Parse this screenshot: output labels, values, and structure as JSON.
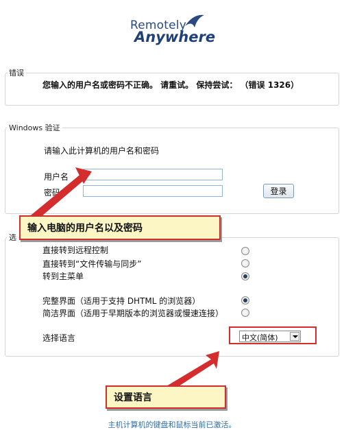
{
  "logo": {
    "line1": "Remotely",
    "line2": "Anywhere"
  },
  "error": {
    "legend": "错误",
    "message": "您输入的用户名或密码不正确。 请重试。 保持尝试： （错误 1326）"
  },
  "auth": {
    "legend": "Windows 验证",
    "prompt": "请输入此计算机的用户名和密码",
    "username_label": "用户名",
    "username_value": "",
    "password_label": "密码",
    "password_value": "",
    "login_button": "登录"
  },
  "options": {
    "legend": "选",
    "items": [
      {
        "label": "直接转到远程控制",
        "selected": false
      },
      {
        "label": "直接转到“文件传输与同步”",
        "selected": false
      },
      {
        "label": "转到主菜单",
        "selected": true
      },
      {
        "label": "完整界面（适用于支持 DHTML 的浏览器）",
        "selected": true
      },
      {
        "label": "简洁界面（适用于早期版本的浏览器或慢速连接）",
        "selected": false
      }
    ],
    "language_label": "选择语言",
    "language_value": "中文(简体)"
  },
  "annotations": {
    "callout1": "输入电脑的用户名以及密码",
    "callout2": "设置语言",
    "border_color": "#d42d2d",
    "fill_color": "#fbf6c4"
  },
  "footer": "主机计算机的键盘和鼠标当前已激活。"
}
